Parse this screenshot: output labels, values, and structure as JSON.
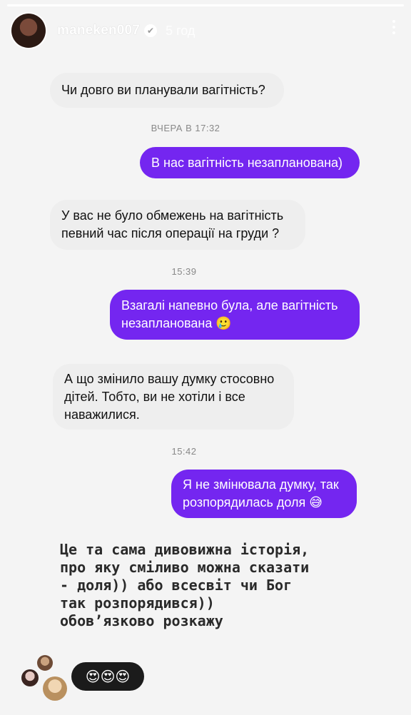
{
  "story": {
    "progress": 1.0,
    "username": "maneken007",
    "time_ago": "5 год",
    "verified_glyph": "✔",
    "more_icon": "three-vertical-dots"
  },
  "chat": {
    "q1": "Чи довго ви планували вагітність?",
    "stamp1": "ВЧЕРА В 17:32",
    "a1": "В нас вагітність незапланована)",
    "q2": "У вас не було обмежень на вагітність певний час після операції на груди ?",
    "stamp2": "15:39",
    "a2": "Взагалі напевно була, але вагітність незапланована 🥲",
    "q3": "А що змінило вашу думку стосовно дітей. Тобто, ви не хотіли і все наважилися.",
    "stamp3": "15:42",
    "a3": "Я не змінювала думку, так розпорядилась доля 😅"
  },
  "caption": "Це та сама дивовижна історія,\nпро яку сміливо можна сказати\n- доля)) або всесвіт чи Бог\nтак розпорядився))\nобов’язково розкажу",
  "reaction": "😍😍😍",
  "colors": {
    "outgoing_bubble": "#7426f0",
    "incoming_bubble": "#eeeeee"
  }
}
